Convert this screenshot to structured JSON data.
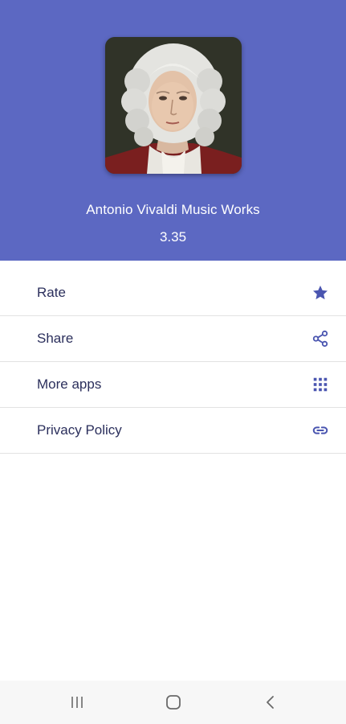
{
  "app": {
    "title": "Antonio Vivaldi Music Works",
    "version": "3.35"
  },
  "colors": {
    "header": "#5c68c2",
    "accent": "#4a55b0",
    "text": "#2b2f5c",
    "divider": "#e2e2e2",
    "navbar": "#f7f7f7"
  },
  "menu": {
    "items": [
      {
        "label": "Rate",
        "icon": "star-icon"
      },
      {
        "label": "Share",
        "icon": "share-icon"
      },
      {
        "label": "More apps",
        "icon": "grid-icon"
      },
      {
        "label": "Privacy Policy",
        "icon": "link-icon"
      }
    ]
  },
  "navbar": {
    "buttons": [
      "recent-apps-icon",
      "home-icon",
      "back-icon"
    ]
  }
}
